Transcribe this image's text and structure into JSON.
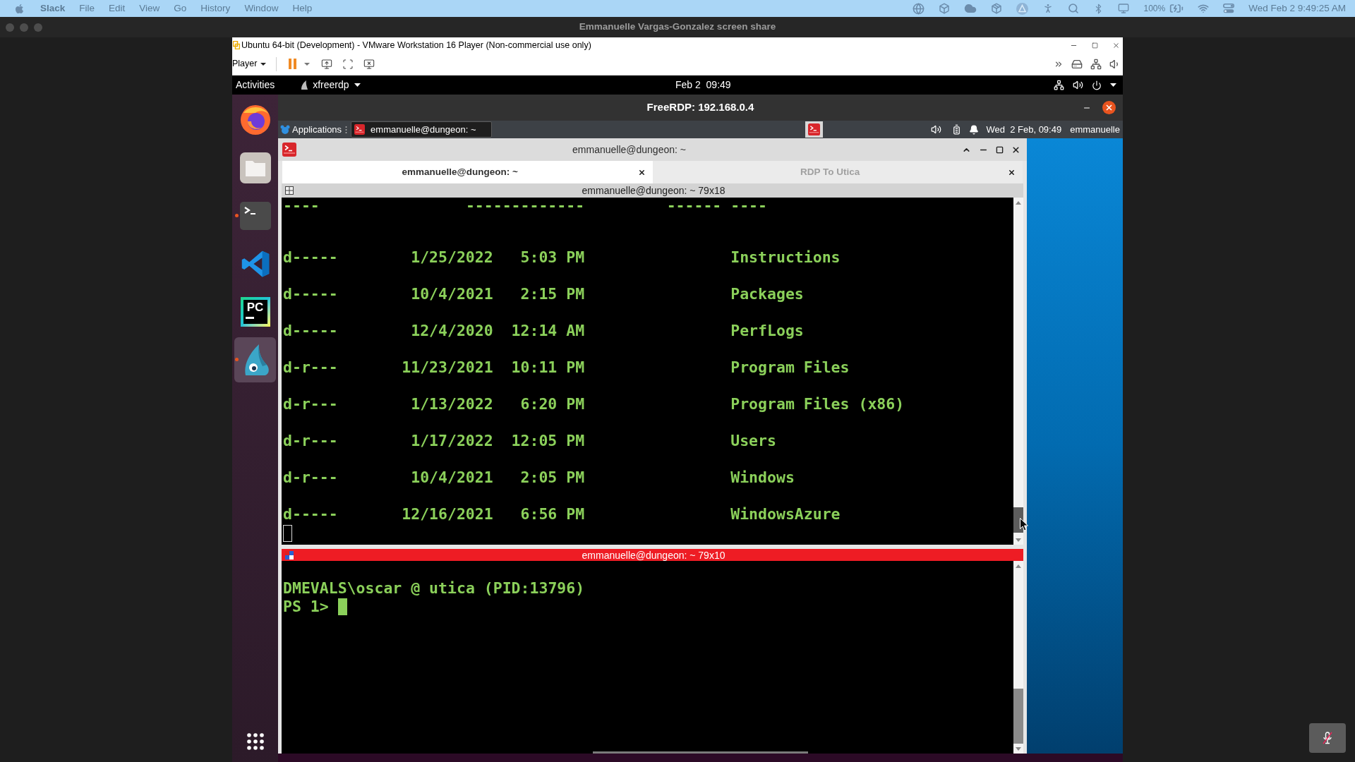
{
  "menu_bar": {
    "app": "Slack",
    "menus": [
      "File",
      "Edit",
      "View",
      "Go",
      "History",
      "Window",
      "Help"
    ],
    "battery": "100%",
    "clock": "Wed Feb 2 9:49:25 AM"
  },
  "share_window": {
    "title": "Emmanuelle Vargas-Gonzalez screen share"
  },
  "vmware": {
    "title": "Ubuntu 64-bit (Development) - VMware Workstation 16 Player (Non-commercial use only)",
    "player_menu": "Player"
  },
  "ubuntu_top_bar": {
    "activities": "Activities",
    "app_menu": "xfreerdp",
    "clock": "Feb 2  09:49"
  },
  "dock": {
    "items": [
      {
        "kind": "browser",
        "running": false,
        "selected": false
      },
      {
        "kind": "files",
        "running": false,
        "selected": false
      },
      {
        "kind": "terminal",
        "running": true,
        "selected": false
      },
      {
        "kind": "code-editor",
        "running": false,
        "selected": false
      },
      {
        "kind": "ide",
        "logo_text": "PC",
        "running": false,
        "selected": false
      },
      {
        "kind": "remote-desktop",
        "running": true,
        "selected": true
      }
    ]
  },
  "freerdp_window": {
    "title": "FreeRDP: 192.168.0.4"
  },
  "remote_panel": {
    "menu": "Applications",
    "tasks": [
      {
        "label": "emmanuelle@dungeon: ~",
        "selected": true
      }
    ],
    "clock": "Wed  2 Feb, 09:49",
    "user": "emmanuelle"
  },
  "terminal": {
    "title": "emmanuelle@dungeon: ~",
    "tabs": [
      {
        "label": "emmanuelle@dungeon: ~",
        "selected": true
      },
      {
        "label": "RDP To Utica",
        "selected": false
      }
    ],
    "panes": [
      {
        "kind": "listing",
        "title": "emmanuelle@dungeon: ~ 79x18",
        "focused": false,
        "rule_line": [
          "----",
          "-------------",
          "------",
          "----"
        ],
        "rows": [
          [
            "d-----",
            "1/25/2022",
            "5:03 PM",
            "Instructions"
          ],
          [
            "d-----",
            "10/4/2021",
            "2:15 PM",
            "Packages"
          ],
          [
            "d-----",
            "12/4/2020",
            "12:14 AM",
            "PerfLogs"
          ],
          [
            "d-r---",
            "11/23/2021",
            "10:11 PM",
            "Program Files"
          ],
          [
            "d-r---",
            "1/13/2022",
            "6:20 PM",
            "Program Files (x86)"
          ],
          [
            "d-r---",
            "1/17/2022",
            "12:05 PM",
            "Users"
          ],
          [
            "d-r---",
            "10/4/2021",
            "2:05 PM",
            "Windows"
          ],
          [
            "d-----",
            "12/16/2021",
            "6:56 PM",
            "WindowsAzure"
          ]
        ]
      },
      {
        "kind": "shell",
        "title": "emmanuelle@dungeon: ~ 79x10",
        "focused": true,
        "lines": [
          "DMEVALS\\oscar @ utica (PID:13796)"
        ],
        "prompt": "PS 1>"
      }
    ]
  }
}
